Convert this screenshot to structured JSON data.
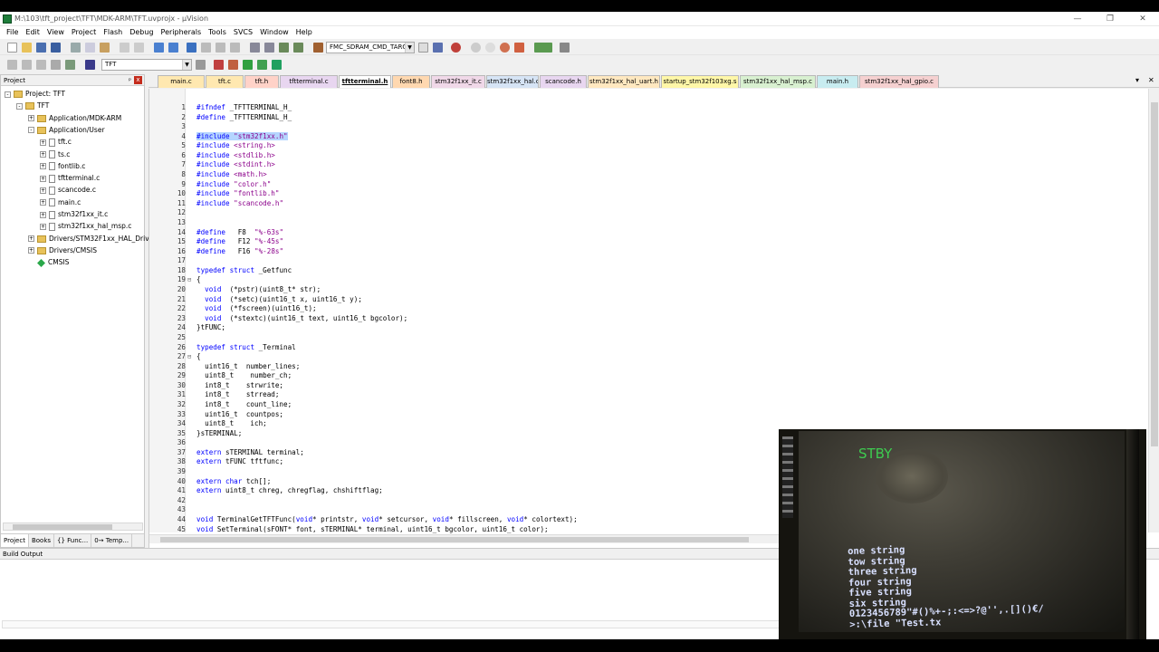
{
  "window": {
    "title": "M:\\103\\tft_project\\TFT\\MDK-ARM\\TFT.uvprojx - µVision",
    "min": "—",
    "max": "❐",
    "close": "✕"
  },
  "menu": [
    "File",
    "Edit",
    "View",
    "Project",
    "Flash",
    "Debug",
    "Peripherals",
    "Tools",
    "SVCS",
    "Window",
    "Help"
  ],
  "toolbar": {
    "find_combo": "FMC_SDRAM_CMD_TARG",
    "target_combo": "TFT"
  },
  "project": {
    "panel_title": "Project",
    "pin": "ᵖ",
    "close": "x",
    "tree": [
      {
        "label": "Project: TFT",
        "level": 0,
        "kind": "root",
        "exp": "-"
      },
      {
        "label": "TFT",
        "level": 1,
        "kind": "folder",
        "exp": "-"
      },
      {
        "label": "Application/MDK-ARM",
        "level": 2,
        "kind": "folder",
        "exp": "+"
      },
      {
        "label": "Application/User",
        "level": 2,
        "kind": "folder",
        "exp": "-"
      },
      {
        "label": "tft.c",
        "level": 3,
        "kind": "file",
        "exp": "+"
      },
      {
        "label": "ts.c",
        "level": 3,
        "kind": "file",
        "exp": "+"
      },
      {
        "label": "fontlib.c",
        "level": 3,
        "kind": "file",
        "exp": "+"
      },
      {
        "label": "tftterminal.c",
        "level": 3,
        "kind": "file",
        "exp": "+"
      },
      {
        "label": "scancode.c",
        "level": 3,
        "kind": "file",
        "exp": "+"
      },
      {
        "label": "main.c",
        "level": 3,
        "kind": "file",
        "exp": "+"
      },
      {
        "label": "stm32f1xx_it.c",
        "level": 3,
        "kind": "file",
        "exp": "+"
      },
      {
        "label": "stm32f1xx_hal_msp.c",
        "level": 3,
        "kind": "file",
        "exp": "+"
      },
      {
        "label": "Drivers/STM32F1xx_HAL_Driv",
        "level": 2,
        "kind": "folder",
        "exp": "+"
      },
      {
        "label": "Drivers/CMSIS",
        "level": 2,
        "kind": "folder",
        "exp": "+"
      },
      {
        "label": "CMSIS",
        "level": 2,
        "kind": "gem",
        "exp": ""
      }
    ],
    "tabs": [
      "Project",
      "Books",
      "{} Func...",
      "0→ Temp..."
    ]
  },
  "editor_tabs": [
    {
      "label": "main.c",
      "color": "#ffe8b0"
    },
    {
      "label": "tft.c",
      "color": "#ffe8b0"
    },
    {
      "label": "tft.h",
      "color": "#ffd2c8"
    },
    {
      "label": "tftterminal.c",
      "color": "#e8d6f0"
    },
    {
      "label": "tftterminal.h",
      "color": "#ffffff",
      "active": true
    },
    {
      "label": "font8.h",
      "color": "#ffd8b0"
    },
    {
      "label": "stm32f1xx_it.c",
      "color": "#f0d8e8"
    },
    {
      "label": "stm32f1xx_hal.c",
      "color": "#d6e4f5"
    },
    {
      "label": "scancode.h",
      "color": "#e8d6f0"
    },
    {
      "label": "stm32f1xx_hal_uart.h",
      "color": "#ffe8c0"
    },
    {
      "label": "startup_stm32f103xg.s",
      "color": "#fff7a8"
    },
    {
      "label": "stm32f1xx_hal_msp.c",
      "color": "#d8f0d0"
    },
    {
      "label": "main.h",
      "color": "#c8ecf0"
    },
    {
      "label": "stm32f1xx_hal_gpio.c",
      "color": "#f5d0d0"
    }
  ],
  "code": [
    "#ifndef _TFTTERMINAL_H_",
    "#define _TFTTERMINAL_H_",
    "",
    "#include \"stm32f1xx.h\"",
    "#include <string.h>",
    "#include <stdlib.h>",
    "#include <stdint.h>",
    "#include <math.h>",
    "#include \"color.h\"",
    "#include \"fontlib.h\"",
    "#include \"scancode.h\"",
    "",
    "",
    "#define   F8  \"%-63s\"",
    "#define   F12 \"%-45s\"",
    "#define   F16 \"%-28s\"",
    "",
    "typedef struct _Getfunc",
    "{",
    "  void  (*pstr)(uint8_t* str);",
    "  void  (*setc)(uint16_t x, uint16_t y);",
    "  void  (*fscreen)(uint16_t);",
    "  void  (*stextc)(uint16_t text, uint16_t bgcolor);",
    "}tFUNC;",
    "",
    "typedef struct _Terminal",
    "{",
    "  uint16_t  number_lines;",
    "  uint8_t    number_ch;",
    "  int8_t    strwrite;",
    "  int8_t    strread;",
    "  int8_t    count_line;",
    "  uint16_t  countpos;",
    "  uint8_t    ich;",
    "}sTERMINAL;",
    "",
    "extern sTERMINAL terminal;",
    "extern tFUNC tftfunc;",
    "",
    "extern char tch[];",
    "extern uint8_t chreg, chregflag, chshiftflag;",
    "",
    "",
    "void TerminalGetTFTFunc(void* printstr, void* setcursor, void* fillscreen, void* colortext);",
    "void SetTerminal(sFONT* font, sTERMINAL* terminal, uint16_t bgcolor, uint16_t color);"
  ],
  "build": {
    "title": "Build Output"
  },
  "camera": {
    "status": "STBY",
    "terminal": "one string\ntow string\nthree string\nfour string\nfive string\nsix string\n0123456789\"#()%+-;:<=>?@'',.[]()€/\n>:\\file \"Test.tx"
  }
}
